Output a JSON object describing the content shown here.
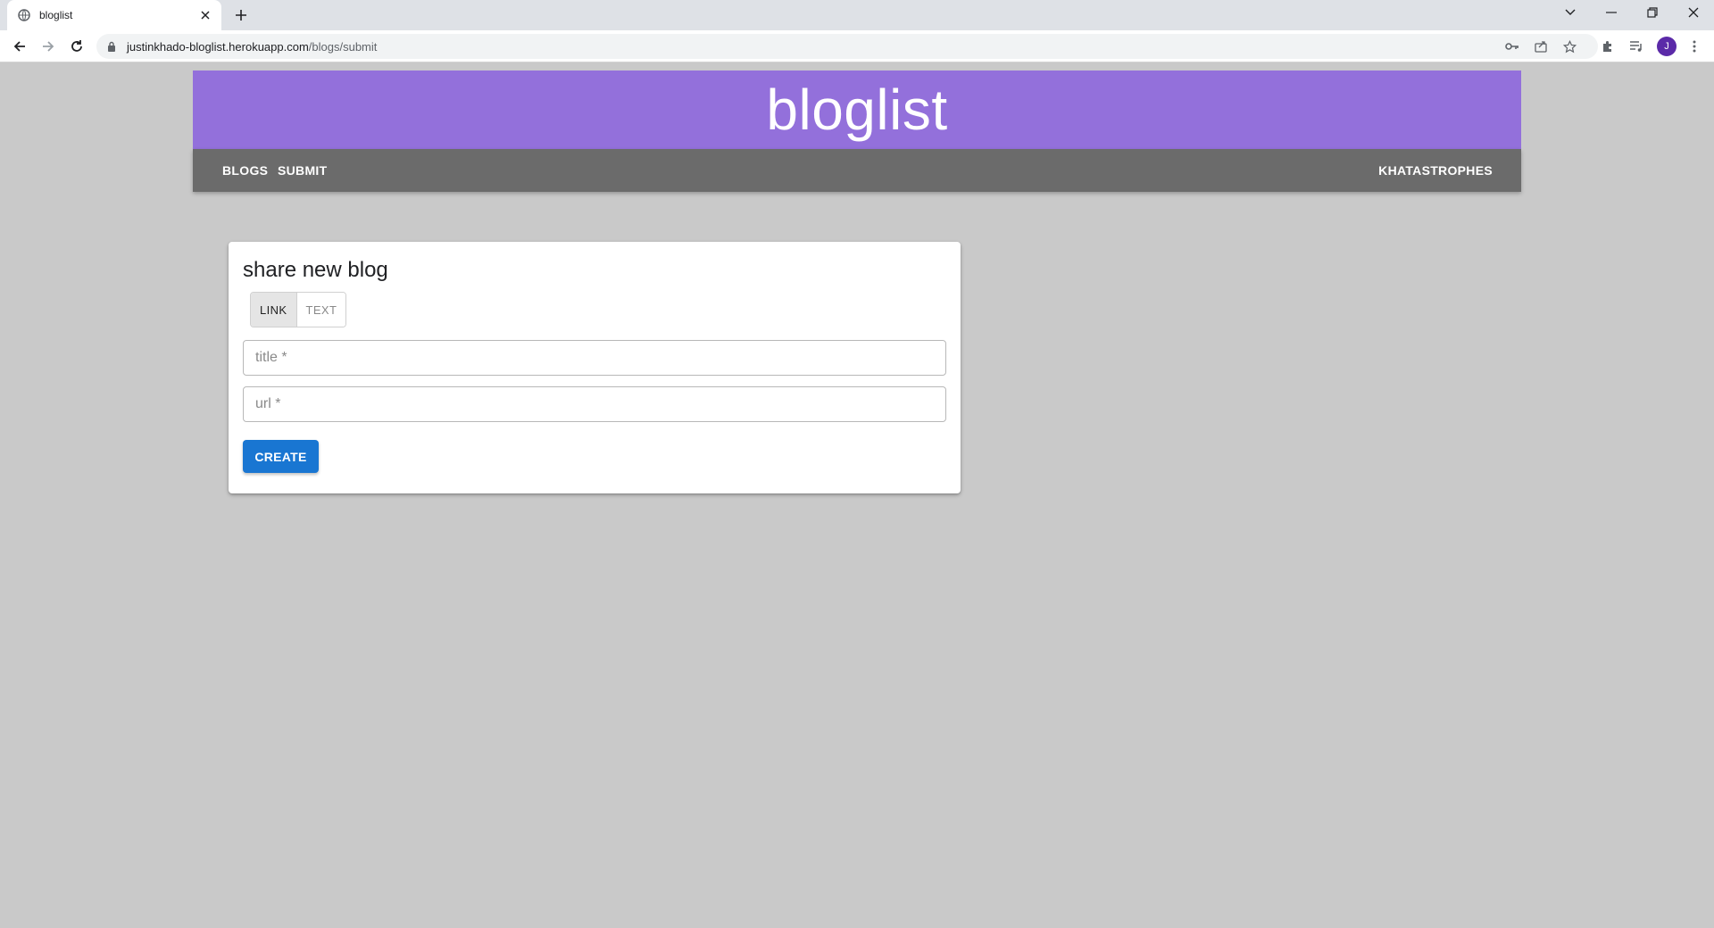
{
  "browser": {
    "tab_title": "bloglist",
    "url_host": "justinkhado-bloglist.herokuapp.com",
    "url_path": "/blogs/submit",
    "profile_initial": "J",
    "icons": [
      "globe-icon",
      "close-icon",
      "plus-icon",
      "chevron-down-icon",
      "minimize-icon",
      "restore-icon",
      "close-window-icon",
      "back-icon",
      "forward-icon",
      "reload-icon",
      "lock-icon",
      "key-icon",
      "share-icon",
      "star-icon",
      "extensions-icon",
      "media-icon",
      "more-icon"
    ]
  },
  "site": {
    "title": "bloglist",
    "accent_color": "#9370db",
    "navbar_color": "#6b6b6b"
  },
  "nav": {
    "blogs": "BLOGS",
    "submit": "SUBMIT",
    "user": "KHATASTROPHES"
  },
  "form": {
    "heading": "share new blog",
    "toggle_link": "LINK",
    "toggle_text": "TEXT",
    "selected_toggle": "LINK",
    "title_placeholder": "title *",
    "title_value": "",
    "url_placeholder": "url *",
    "url_value": "",
    "create_label": "CREATE",
    "button_color": "#1976d2"
  }
}
